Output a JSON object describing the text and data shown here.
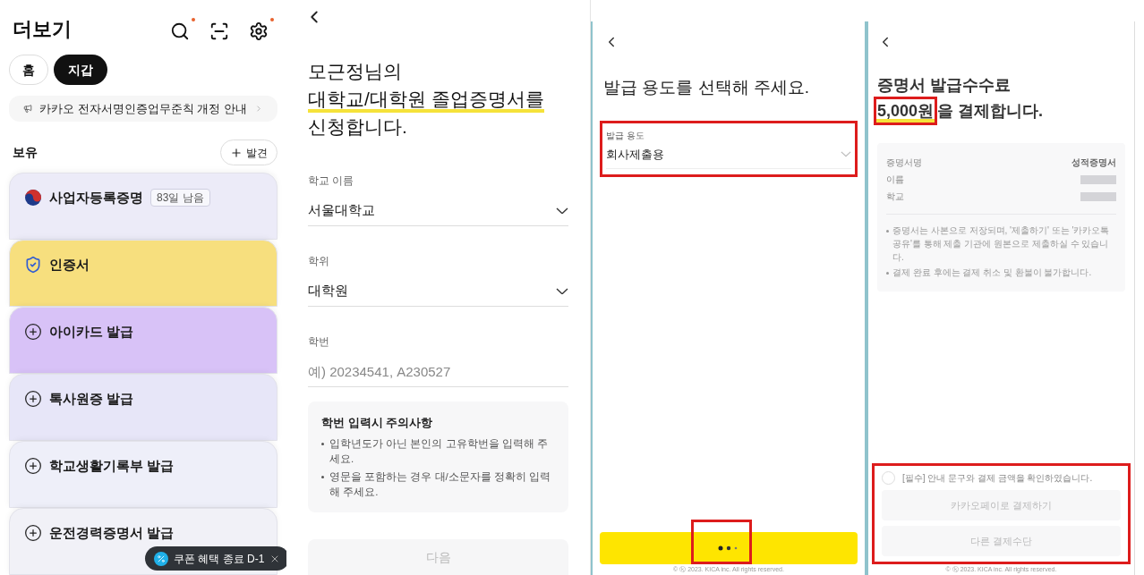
{
  "wallet": {
    "title": "더보기",
    "header_icons": [
      {
        "kind": "search",
        "badge": true
      },
      {
        "kind": "scan",
        "badge": false
      },
      {
        "kind": "settings",
        "badge": true
      }
    ],
    "tabs": [
      {
        "label": "홈",
        "selected": false
      },
      {
        "label": "지갑",
        "selected": true
      }
    ],
    "notice": "카카오 전자서명인증업무준칙 개정 안내",
    "section_title": "보유",
    "discover_button": "발견",
    "cards": [
      {
        "kind": "document",
        "title": "사업자등록증명",
        "badge": "83일 남음",
        "color": "#ecebf8"
      },
      {
        "kind": "certificate",
        "title": "인증서",
        "color": "#f7df7e"
      },
      {
        "kind": "issue",
        "title": "아이카드 발급",
        "color": "#d8c2f7"
      },
      {
        "kind": "issue",
        "title": "톡사원증 발급",
        "color": "#e7e6f8"
      },
      {
        "kind": "issue",
        "title": "학교생활기록부 발급",
        "color": "#eeeff9"
      },
      {
        "kind": "issue",
        "title": "운전경력증명서 발급",
        "color": "#f1f1f7"
      }
    ],
    "tooltip": "쿠폰 혜택 종료 D-1"
  },
  "application": {
    "title_lines": [
      {
        "text": "모근정님의",
        "underlined": false
      },
      {
        "text": "대학교/대학원 졸업증명서를",
        "underlined": true
      },
      {
        "text": "신청합니다.",
        "underlined": false
      }
    ],
    "fields": [
      {
        "label": "학교 이름",
        "value": "서울대학교",
        "kind": "select"
      },
      {
        "label": "학위",
        "value": "대학원",
        "kind": "select"
      },
      {
        "label": "학번",
        "placeholder": "예) 20234541, A230527",
        "kind": "input"
      }
    ],
    "notice_title": "학번 입력시 주의사항",
    "notice_items": [
      "입학년도가 아닌 본인의 고유학번을 입력해 주세요.",
      "영문을 포함하는 경우 대/소문자를 정확히 입력해 주세요."
    ],
    "next_button": {
      "label": "다음",
      "disabled": true
    }
  },
  "purpose": {
    "title": "발급 용도를 선택해 주세요.",
    "field": {
      "label": "발급 용도",
      "value": "회사제출용",
      "highlighted": true
    },
    "button": {
      "loading": true,
      "highlighted": true
    },
    "footer": "© ⓚ 2023. KICA inc. All rights reserved."
  },
  "payment": {
    "title": "증명서 발급수수료",
    "amount": "5,000원",
    "amount_highlighted": true,
    "title_rest": "을 결제합니다.",
    "rows": [
      {
        "label": "증명서명",
        "value": "성적증명서",
        "redacted": false
      },
      {
        "label": "이름",
        "redacted": true
      },
      {
        "label": "학교",
        "redacted": true
      }
    ],
    "notes": [
      "증명서는 사본으로 저장되며, '제출하기' 또는 '카카오톡 공유'를 통해 제출 기관에 원본으로 제출하실 수 있습니다.",
      "결제 완료 후에는 결제 취소 및 환불이 불가합니다."
    ],
    "agreement": {
      "label": "[필수] 안내 문구와 결제 금액을 확인하였습니다.",
      "checked": false
    },
    "buttons": [
      {
        "label": "카카오페이로 결제하기",
        "disabled": true
      },
      {
        "label": "다른 결제수단",
        "disabled": true
      }
    ],
    "bottom_highlighted": true,
    "footer": "© ⓚ 2023. KICA inc. All rights reserved."
  }
}
